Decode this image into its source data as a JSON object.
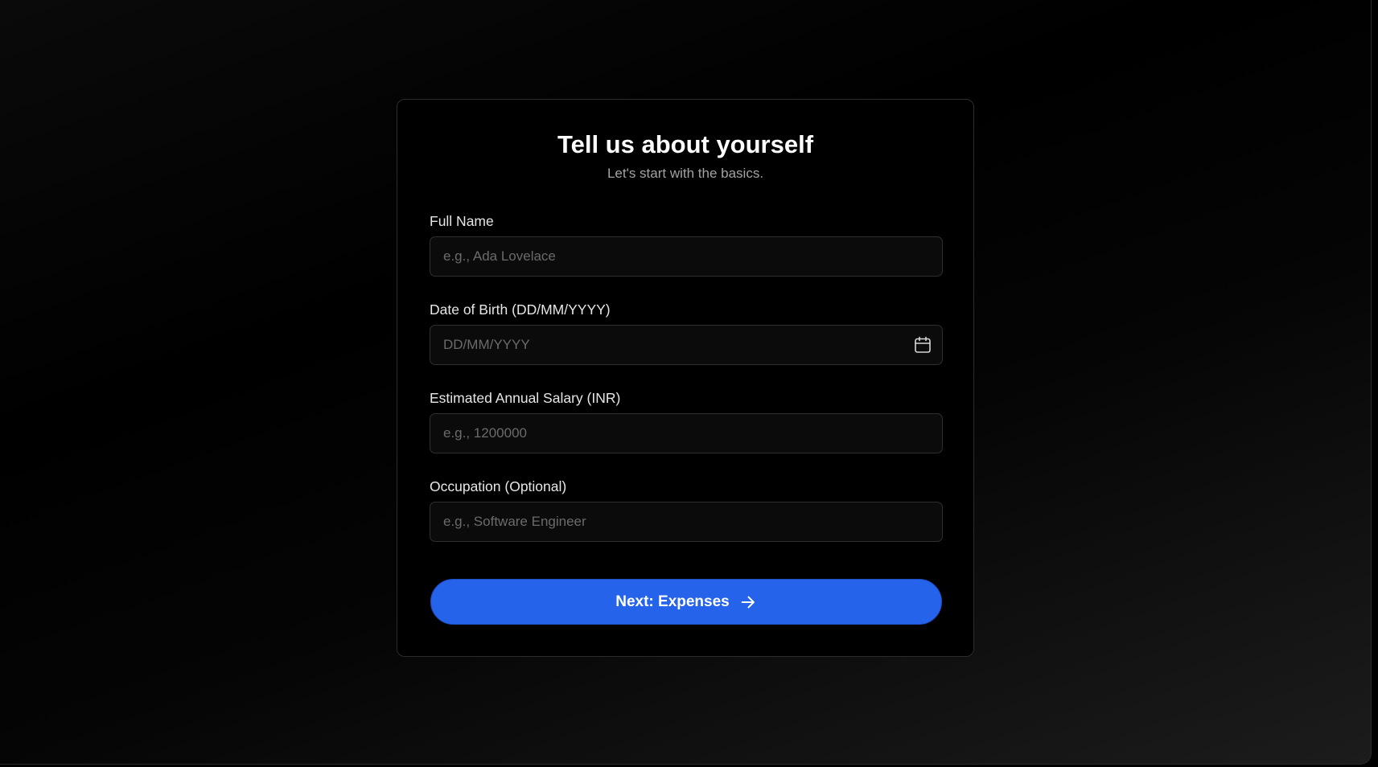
{
  "form": {
    "title": "Tell us about yourself",
    "subtitle": "Let's start with the basics.",
    "fields": [
      {
        "label": "Full Name",
        "placeholder": "e.g., Ada Lovelace",
        "value": ""
      },
      {
        "label": "Date of Birth (DD/MM/YYYY)",
        "placeholder": "DD/MM/YYYY",
        "value": "",
        "icon": "calendar-icon"
      },
      {
        "label": "Estimated Annual Salary (INR)",
        "placeholder": "e.g., 1200000",
        "value": ""
      },
      {
        "label": "Occupation (Optional)",
        "placeholder": "e.g., Software Engineer",
        "value": ""
      }
    ],
    "submit": {
      "label": "Next: Expenses",
      "icon": "arrow-right-icon"
    }
  },
  "colors": {
    "background": "#000000",
    "card_border": "#2c2c2c",
    "input_background": "#0b0b0b",
    "accent": "#2563eb",
    "text": "#ffffff",
    "muted_text": "#a3a3a3",
    "placeholder": "#6b6b6b"
  }
}
